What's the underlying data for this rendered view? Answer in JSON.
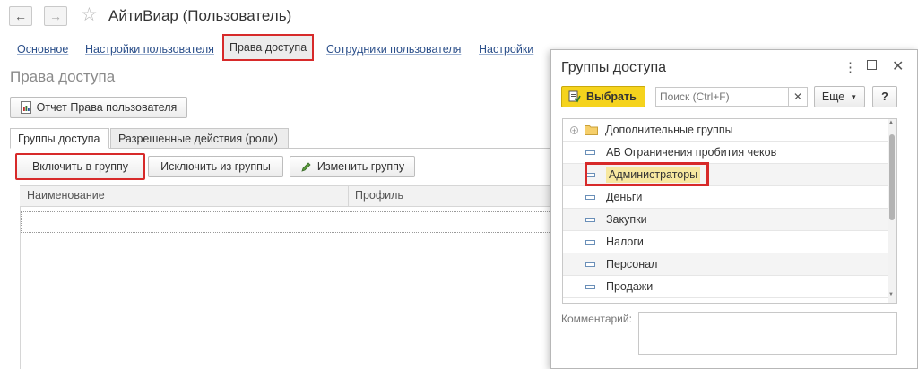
{
  "window": {
    "title": "АйтиВиар (Пользователь)",
    "back_icon": "arrow-left-icon",
    "forward_icon": "arrow-right-icon",
    "favorite_icon": "star-icon"
  },
  "top_tabs": [
    {
      "label": "Основное"
    },
    {
      "label": "Настройки пользователя"
    },
    {
      "label": "Права доступа",
      "active": true
    },
    {
      "label": "Сотрудники пользователя"
    },
    {
      "label": "Настройки"
    }
  ],
  "section_title": "Права доступа",
  "report_button": {
    "label": "Отчет Права пользователя",
    "icon": "report-icon"
  },
  "sub_tabs": [
    {
      "label": "Группы доступа",
      "active": true
    },
    {
      "label": "Разрешенные действия (роли)"
    }
  ],
  "toolbar": {
    "include_label": "Включить в группу",
    "exclude_label": "Исключить из группы",
    "edit_label": "Изменить группу",
    "edit_icon": "pencil-icon"
  },
  "grid": {
    "columns": [
      "Наименование",
      "Профиль"
    ]
  },
  "dialog": {
    "title": "Группы доступа",
    "select_label": "Выбрать",
    "search_placeholder": "Поиск (Ctrl+F)",
    "more_label": "Еще",
    "help_label": "?",
    "items": [
      {
        "label": "Дополнительные группы",
        "type": "folder"
      },
      {
        "label": "АВ Ограничения пробития чеков",
        "type": "item"
      },
      {
        "label": "Администраторы",
        "type": "item",
        "selected": true
      },
      {
        "label": "Деньги",
        "type": "item"
      },
      {
        "label": "Закупки",
        "type": "item"
      },
      {
        "label": "Налоги",
        "type": "item"
      },
      {
        "label": "Персонал",
        "type": "item"
      },
      {
        "label": "Продажи",
        "type": "item"
      }
    ],
    "comment_label": "Комментарий:"
  },
  "colors": {
    "highlight_border": "#d72a2a",
    "select_button": "#f5d31d",
    "link": "#2b4f8a",
    "selected_row": "#f7e8a0"
  }
}
